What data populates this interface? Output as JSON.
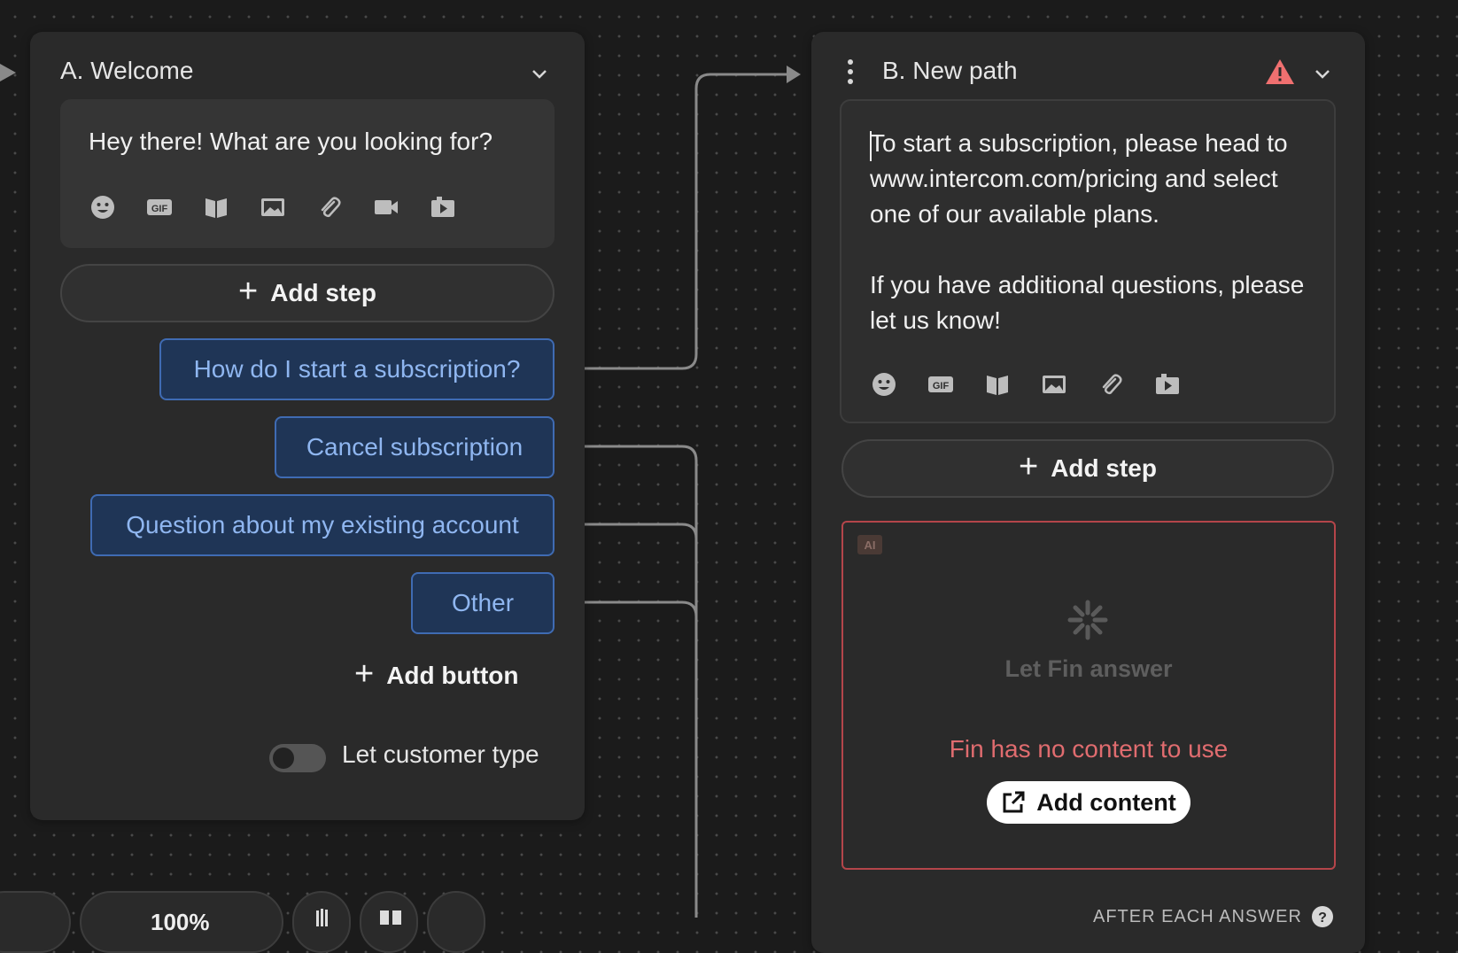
{
  "card_a": {
    "title": "A. Welcome",
    "message": "Hey there! What are you looking for?",
    "add_step": "Add step",
    "replies": [
      "How do I start a subscription?",
      "Cancel subscription",
      "Question about my existing account",
      "Other"
    ],
    "add_button": "Add button",
    "toggle_label": "Let customer type",
    "toggle_on": false
  },
  "card_b": {
    "title": "B. New path",
    "message": "To start a subscription, please head to www.intercom.com/pricing and select one of our available plans.\n\nIf you have additional questions, please let us know!",
    "add_step": "Add step",
    "fin_badge": "AI",
    "fin_title": "Let Fin answer",
    "fin_error": "Fin has no content to use",
    "add_content": "Add content",
    "after_each": "AFTER EACH ANSWER"
  },
  "bottom_toolbar": {
    "zoom": "100%"
  },
  "colors": {
    "accent_reply_bg": "#1f3556",
    "accent_reply_border": "#3f6bb3",
    "reply_text": "#8fb6f0",
    "error": "#e06c6f",
    "warning": "#f07070"
  },
  "icons": [
    "emoji-icon",
    "gif-icon",
    "article-icon",
    "image-icon",
    "attachment-icon",
    "video-icon",
    "app-icon",
    "warning-icon",
    "chevron-down-icon",
    "fin-logo-icon",
    "external-link-icon",
    "help-icon"
  ]
}
